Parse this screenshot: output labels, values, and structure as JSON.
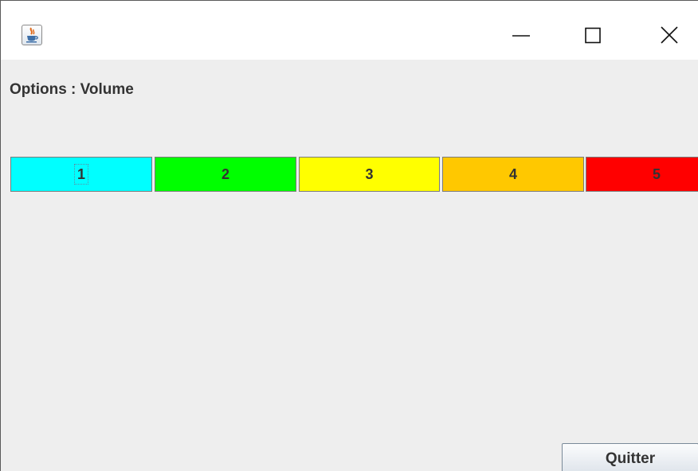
{
  "window": {
    "app_icon": "java-cup-icon",
    "controls": {
      "minimize_icon": "minimize-icon",
      "maximize_icon": "maximize-icon",
      "close_icon": "close-icon"
    }
  },
  "content": {
    "label": "Options : Volume",
    "volume_levels": [
      {
        "label": "1",
        "color": "#00ffff",
        "focused": true
      },
      {
        "label": "2",
        "color": "#00ff00",
        "focused": false
      },
      {
        "label": "3",
        "color": "#ffff00",
        "focused": false
      },
      {
        "label": "4",
        "color": "#ffc800",
        "focused": false
      },
      {
        "label": "5",
        "color": "#ff0000",
        "focused": false
      }
    ],
    "quit_label": "Quitter"
  }
}
